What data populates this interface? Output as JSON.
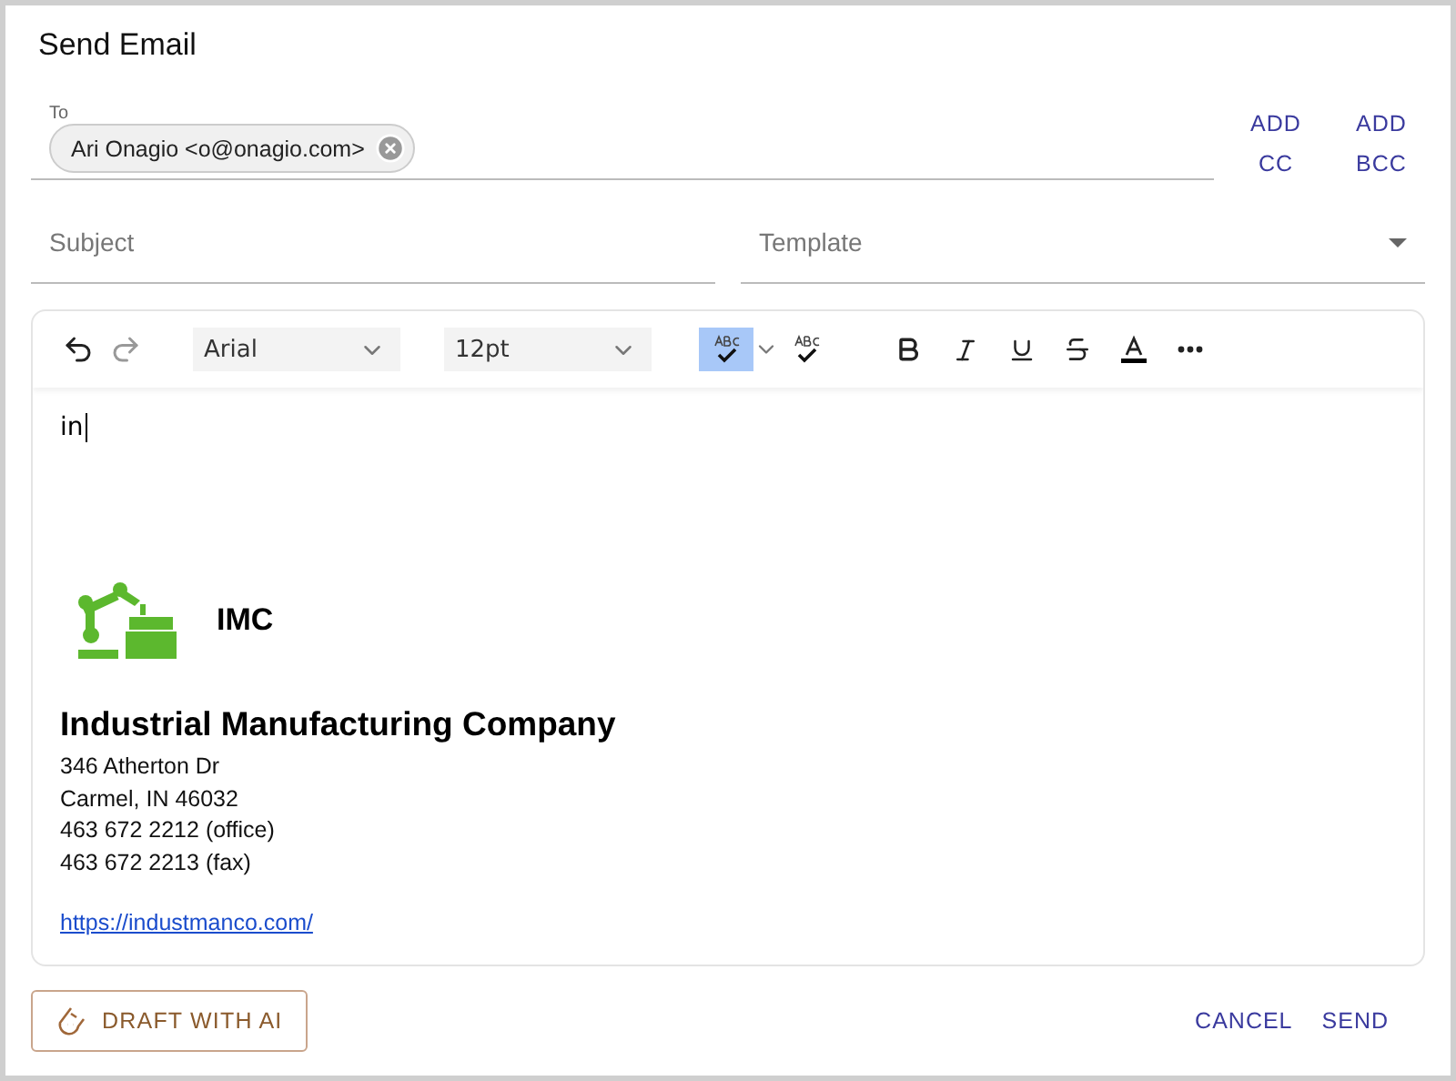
{
  "title": "Send Email",
  "to": {
    "label": "To",
    "chips": [
      {
        "text": "Ari Onagio <o@onagio.com>"
      }
    ]
  },
  "add_buttons": [
    "ADD CC",
    "ADD BCC"
  ],
  "subject": {
    "placeholder": "Subject"
  },
  "template": {
    "placeholder": "Template"
  },
  "toolbar": {
    "history": [
      {
        "kind": "undo",
        "disabled": false
      },
      {
        "kind": "redo",
        "disabled": true
      }
    ],
    "font": "Arial",
    "size": "12pt",
    "spellcheck_on": true,
    "format": [
      {
        "kind": "bold"
      },
      {
        "kind": "italic"
      },
      {
        "kind": "underline"
      },
      {
        "kind": "strike"
      },
      {
        "kind": "color"
      },
      {
        "kind": "more"
      }
    ]
  },
  "body": {
    "text": "in",
    "logo_text": "IMC",
    "company": "Industrial Manufacturing Company",
    "lines": [
      "346 Atherton Dr",
      "Carmel, IN 46032",
      "463 672 2212 (office)",
      "463 672 2213 (fax)"
    ],
    "link": "https://industmanco.com/"
  },
  "footer": {
    "draft": "DRAFT WITH AI",
    "cancel": "CANCEL",
    "send": "SEND"
  }
}
